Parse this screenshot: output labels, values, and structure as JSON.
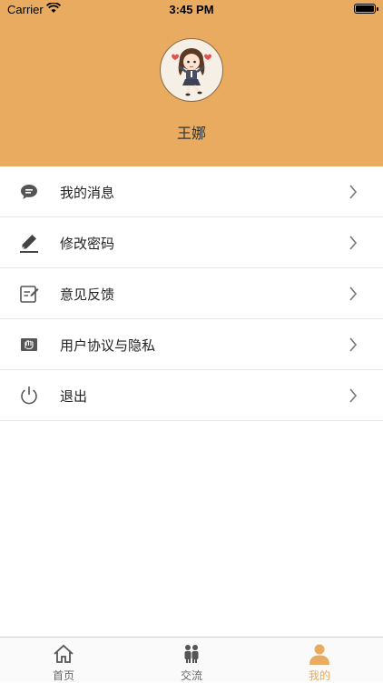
{
  "status_bar": {
    "carrier": "Carrier",
    "time": "3:45 PM"
  },
  "profile": {
    "name": "王娜"
  },
  "menu": [
    {
      "label": "我的消息",
      "icon": "message-bubble-icon"
    },
    {
      "label": "修改密码",
      "icon": "pencil-icon"
    },
    {
      "label": "意见反馈",
      "icon": "feedback-icon"
    },
    {
      "label": "用户协议与隐私",
      "icon": "agreement-icon"
    },
    {
      "label": "退出",
      "icon": "power-icon"
    }
  ],
  "tabs": [
    {
      "label": "首页",
      "icon": "home-icon",
      "active": false
    },
    {
      "label": "交流",
      "icon": "people-icon",
      "active": false
    },
    {
      "label": "我的",
      "icon": "user-icon",
      "active": true
    }
  ],
  "colors": {
    "accent": "#E9AB60",
    "divider": "#e6e6e6",
    "text": "#222222"
  }
}
